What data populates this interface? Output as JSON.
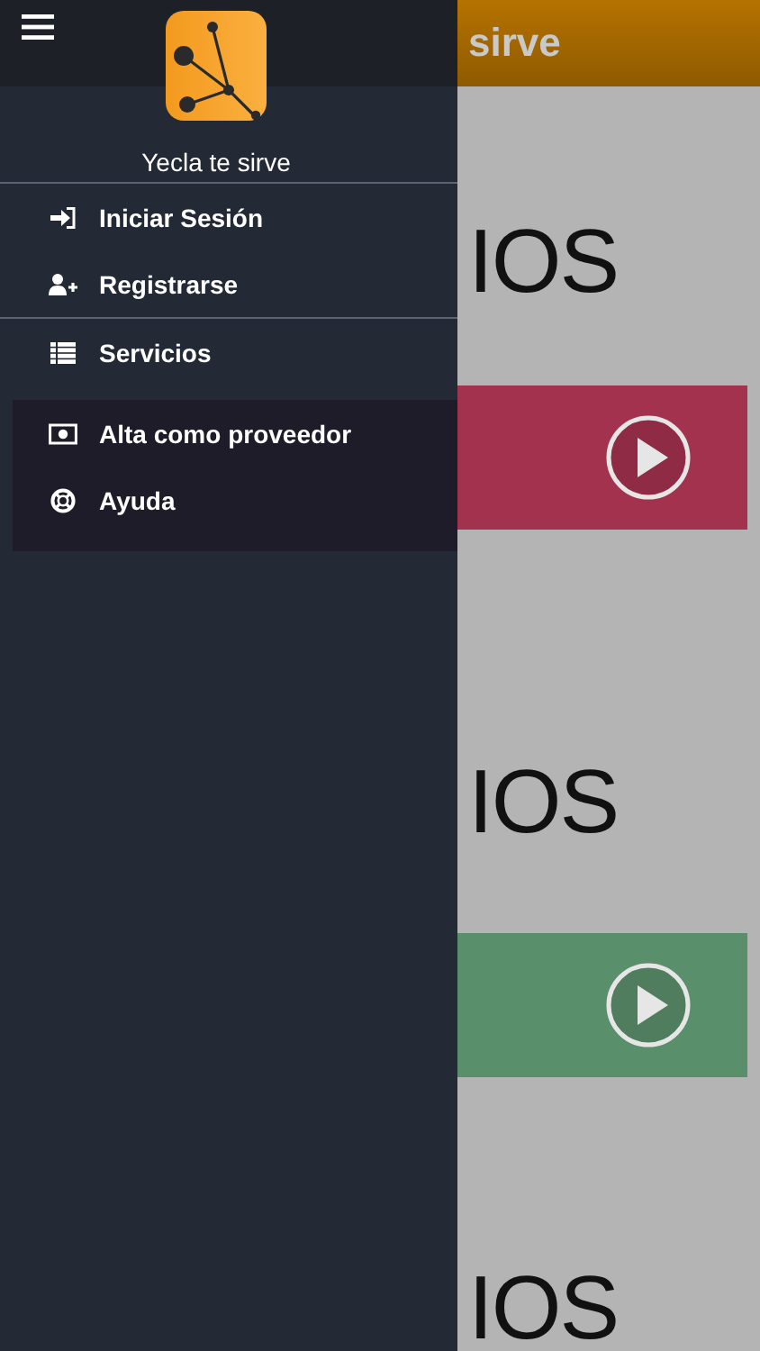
{
  "header": {
    "title": "sirve"
  },
  "sections": [
    {
      "title": "IOS",
      "color": "#a3324f"
    },
    {
      "title": "IOS",
      "color": "#5a8f6c"
    },
    {
      "title": "IOS"
    }
  ],
  "drawer": {
    "app_name": "Yecla te sirve",
    "account_items": [
      {
        "label": "Iniciar Sesión"
      },
      {
        "label": "Registrarse"
      }
    ],
    "items": [
      {
        "label": "Servicios"
      }
    ],
    "panel_items": [
      {
        "label": "Alta como proveedor"
      },
      {
        "label": "Ayuda"
      }
    ]
  }
}
